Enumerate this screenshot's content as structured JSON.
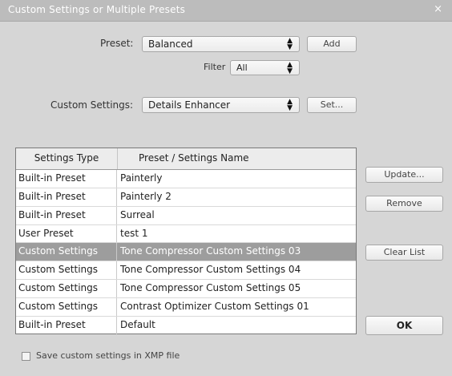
{
  "dialog": {
    "title": "Custom Settings or Multiple Presets",
    "close_glyph": "×"
  },
  "preset": {
    "label": "Preset:",
    "value": "Balanced",
    "add_label": "Add"
  },
  "filter": {
    "label": "Filter",
    "value": "All"
  },
  "custom_settings": {
    "label": "Custom Settings:",
    "value": "Details Enhancer",
    "set_label": "Set..."
  },
  "table": {
    "headers": [
      "Settings Type",
      "Preset / Settings Name"
    ],
    "rows": [
      {
        "type": "Built-in Preset",
        "name": "Painterly"
      },
      {
        "type": "Built-in Preset",
        "name": "Painterly 2"
      },
      {
        "type": "Built-in Preset",
        "name": "Surreal"
      },
      {
        "type": "User Preset",
        "name": "test 1"
      },
      {
        "type": "Custom Settings",
        "name": "Tone Compressor Custom Settings 03",
        "selected": true
      },
      {
        "type": "Custom Settings",
        "name": "Tone Compressor Custom Settings 04"
      },
      {
        "type": "Custom Settings",
        "name": "Tone Compressor Custom Settings 05"
      },
      {
        "type": "Custom Settings",
        "name": "Contrast Optimizer Custom Settings 01"
      },
      {
        "type": "Built-in Preset",
        "name": "Default"
      }
    ]
  },
  "buttons": {
    "update": "Update...",
    "remove": "Remove",
    "clear_list": "Clear List",
    "ok": "OK"
  },
  "xmp": {
    "label": "Save custom settings in XMP file",
    "checked": false
  },
  "icons": {
    "select_arrows": "▲▼"
  }
}
